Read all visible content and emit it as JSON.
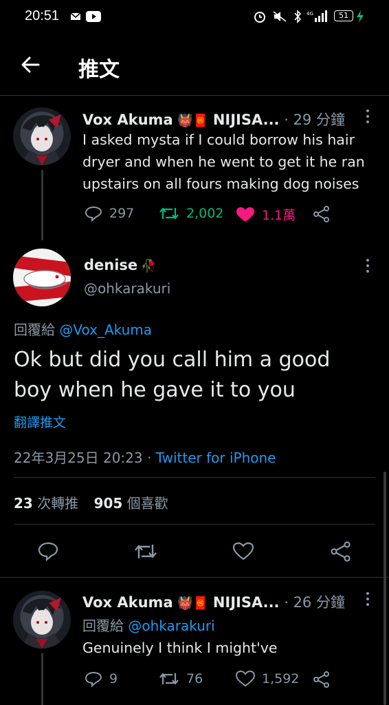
{
  "status_bar": {
    "time": "20:51",
    "battery": "51"
  },
  "header": {
    "title": "推文"
  },
  "tweet1": {
    "name": "Vox Akuma",
    "emoji": "👹🧧",
    "affiliation": "NIJISA...",
    "time": "· 29 分鐘",
    "text_lines": [
      "I asked mysta if I could borrow his hair",
      "dryer and when he went to get it he ran",
      "upstairs on all fours making dog noises"
    ],
    "replies": "297",
    "retweets": "2,002",
    "likes": "1.1萬"
  },
  "main_tweet": {
    "name": "denise",
    "emoji": "🥀",
    "handle": "@ohkarakuri",
    "reply_to_label": "回覆給",
    "reply_to_handle": "@Vox_Akuma",
    "text_lines": [
      "Ok but did you call him a good",
      "boy when he gave it to you"
    ],
    "translate": "翻譯推文",
    "datetime": "22年3月25日 20:23 ·",
    "source": "Twitter for iPhone",
    "retweet_count": "23",
    "retweet_label": "次轉推",
    "like_count": "905",
    "like_label": "個喜歡"
  },
  "tweet3": {
    "name": "Vox Akuma",
    "emoji": "👹🧧",
    "affiliation": "NIJISA...",
    "time": "· 26 分鐘",
    "reply_to_label": "回覆給",
    "reply_to_handle": "@ohkarakuri",
    "text": "Genuinely I think I might've",
    "replies": "9",
    "retweets": "76",
    "likes": "1,592"
  },
  "colors": {
    "like_pink": "#f91880",
    "retweet_green": "#00ba7c",
    "link_blue": "#1d9bf0"
  }
}
